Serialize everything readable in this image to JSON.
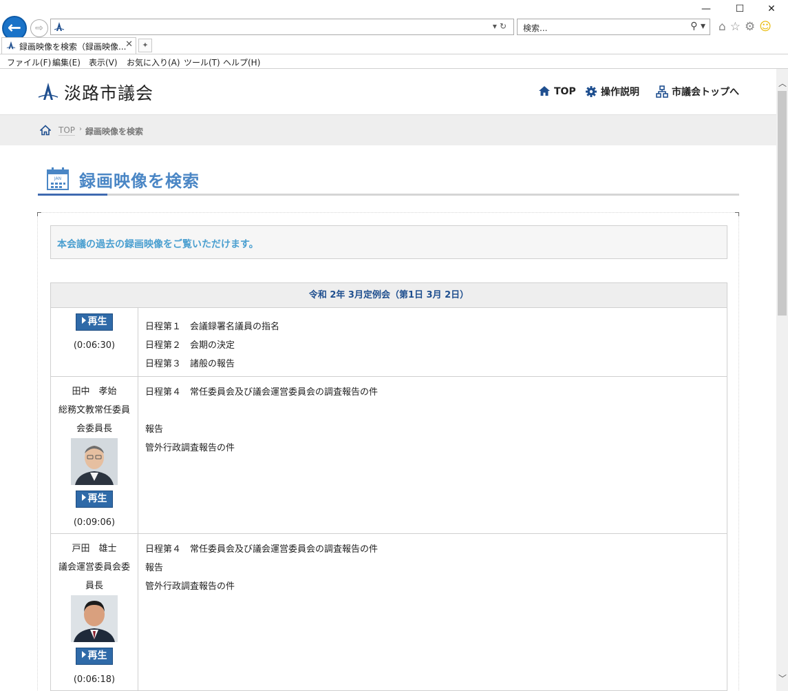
{
  "browser": {
    "minimize": "—",
    "maximize": "☐",
    "close": "✕",
    "search_placeholder": "検索...",
    "tab_title": "録画映像を検索（録画映像...",
    "menu": [
      "ファイル(F)",
      "編集(E)",
      "表示(V)",
      "お気に入り(A)",
      "ツール(T)",
      "ヘルプ(H)"
    ]
  },
  "site": {
    "name": "淡路市議会",
    "nav": {
      "top": "TOP",
      "help": "操作説明",
      "council_top": "市議会トップへ"
    },
    "breadcrumb": {
      "top": "TOP",
      "current": "録画映像を検索"
    }
  },
  "page": {
    "title": "録画映像を検索",
    "intro": "本会議の過去の録画映像をご覧いただけます。",
    "calendar_label": "JAN"
  },
  "session": {
    "heading": "令和 2年 3月定例会（第1日 3月 2日）",
    "play_label": "再生",
    "rows": [
      {
        "speaker_name": "",
        "speaker_role_1": "",
        "speaker_role_2": "",
        "duration": "(0:06:30)",
        "items": [
          "日程第１　会議録署名議員の指名",
          "日程第２　会期の決定",
          "日程第３　諸般の報告"
        ]
      },
      {
        "speaker_name": "田中　孝始",
        "speaker_role_1": "総務文教常任委員",
        "speaker_role_2": "会委員長",
        "duration": "(0:09:06)",
        "items": [
          "日程第４　常任委員会及び議会運営委員会の調査報告の件",
          "",
          "報告",
          "管外行政調査報告の件"
        ]
      },
      {
        "speaker_name": "戸田　雄士",
        "speaker_role_1": "議会運営委員会委",
        "speaker_role_2": "員長",
        "duration": "(0:06:18)",
        "items": [
          "日程第４　常任委員会及び議会運営委員会の調査報告の件",
          "報告",
          "管外行政調査報告の件"
        ]
      }
    ]
  },
  "colors": {
    "accent_blue": "#4a86c5",
    "nav_blue": "#1f4f8f",
    "play_button": "#2f6aa8",
    "intro_text": "#4a9fd0"
  }
}
